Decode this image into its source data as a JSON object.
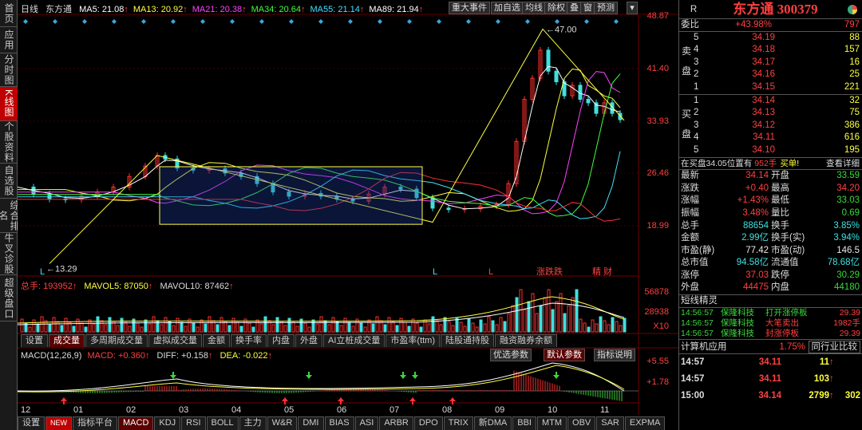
{
  "side_tabs": [
    "首页",
    "应用",
    "分时图",
    "K线图",
    "个股资料",
    "自选股",
    "综合排名",
    "牛叉诊股",
    "超级盘口"
  ],
  "legend": {
    "period": "日线",
    "name": "东方通",
    "ma": [
      {
        "t": "MA5: 21.08",
        "c": "#ffffff"
      },
      {
        "t": "MA13: 20.92",
        "c": "#ffff40"
      },
      {
        "t": "MA21: 20.38",
        "c": "#ff40ff"
      },
      {
        "t": "MA34: 20.64",
        "c": "#40ff40"
      },
      {
        "t": "MA55: 21.14",
        "c": "#40e0ff"
      },
      {
        "t": "MA89: 21.94",
        "c": "#ffffff"
      }
    ]
  },
  "toolbar": [
    "重大事件",
    "加自选",
    "均线",
    "除权",
    "叠",
    "窗",
    "预测"
  ],
  "price_axis": [
    "48.87",
    "41.40",
    "33.93",
    "26.46",
    "18.99"
  ],
  "annot_high": "47.00",
  "annot_low": "13.29",
  "markers_L": [
    "L",
    "L",
    "L",
    "L"
  ],
  "marker_special": "涨跌跌",
  "marker_jing": "精 财",
  "vol": {
    "label": "总手: 193952",
    "ma5": "MAVOL5: 87050",
    "ma10": "MAVOL10: 87462",
    "axis": [
      "56878",
      "28938",
      "X10"
    ]
  },
  "vol_tabs": [
    "设置",
    "成交量",
    "多周期成交量",
    "虚拟成交量",
    "金额",
    "换手率",
    "内盘",
    "外盘",
    "AI立桩成交量",
    "市盈率(ttm)",
    "陆股通持股",
    "融资融券余额"
  ],
  "macd": {
    "label": "MACD(12,26,9)",
    "macd": "MACD: +0.360",
    "diff": "DIFF: +0.158",
    "dea": "DEA: -0.022",
    "axis": [
      "+5.55",
      "+1.78"
    ],
    "btns": [
      "优选参数",
      "默认参数",
      "指标说明"
    ]
  },
  "months": [
    "12",
    "01",
    "02",
    "03",
    "04",
    "05",
    "06",
    "07",
    "08",
    "09",
    "10",
    "11"
  ],
  "bottom_tabs": [
    "设置",
    "NEW",
    "指标平台",
    "MACD",
    "KDJ",
    "RSI",
    "BOLL",
    "主力",
    "W&R",
    "DMI",
    "BIAS",
    "ASI",
    "ARBR",
    "DPO",
    "TRIX",
    "新DMA",
    "BBI",
    "MTM",
    "OBV",
    "SAR",
    "EXPMA"
  ],
  "stock": {
    "code_label": "R",
    "title": "东方通 300379"
  },
  "weibi": {
    "label": "委比",
    "pct": "+43.98%",
    "val": "797"
  },
  "asks": [
    {
      "n": "5",
      "p": "34.19",
      "v": "88"
    },
    {
      "n": "4",
      "p": "34.18",
      "v": "157"
    },
    {
      "n": "3",
      "p": "34.17",
      "v": "16"
    },
    {
      "n": "2",
      "p": "34.16",
      "v": "25"
    },
    {
      "n": "1",
      "p": "34.15",
      "v": "221"
    }
  ],
  "bids": [
    {
      "n": "1",
      "p": "34.14",
      "v": "32"
    },
    {
      "n": "2",
      "p": "34.13",
      "v": "75"
    },
    {
      "n": "3",
      "p": "34.12",
      "v": "386"
    },
    {
      "n": "4",
      "p": "34.11",
      "v": "616"
    },
    {
      "n": "5",
      "p": "34.10",
      "v": "195"
    }
  ],
  "ask_label": "卖盘",
  "bid_label": "买盘",
  "info_line": {
    "a": "在买盘34.05位置有",
    "b": "952手",
    "c": "买单!",
    "d": "查看详细"
  },
  "quotes": [
    {
      "l1": "最新",
      "v1": "34.14",
      "c1": "red",
      "l2": "开盘",
      "v2": "33.59",
      "c2": "green"
    },
    {
      "l1": "涨跌",
      "v1": "+0.40",
      "c1": "red",
      "l2": "最高",
      "v2": "34.20",
      "c2": "red"
    },
    {
      "l1": "涨幅",
      "v1": "+1.43%",
      "c1": "red",
      "l2": "最低",
      "v2": "33.03",
      "c2": "green"
    },
    {
      "l1": "振幅",
      "v1": "3.48%",
      "c1": "red",
      "l2": "量比",
      "v2": "0.69",
      "c2": "green"
    },
    {
      "l1": "总手",
      "v1": "88654",
      "c1": "cyan",
      "l2": "换手",
      "v2": "3.85%",
      "c2": "cyan"
    },
    {
      "l1": "金额",
      "v1": "2.99亿",
      "c1": "cyan",
      "l2": "换手(实)",
      "v2": "3.94%",
      "c2": "cyan"
    },
    {
      "l1": "市盈(静)",
      "v1": "77.42",
      "c1": "wht",
      "l2": "市盈(动)",
      "v2": "146.5",
      "c2": "wht"
    },
    {
      "l1": "总市值",
      "v1": "94.58亿",
      "c1": "cyan",
      "l2": "流通值",
      "v2": "78.68亿",
      "c2": "cyan"
    },
    {
      "l1": "涨停",
      "v1": "37.03",
      "c1": "red",
      "l2": "跌停",
      "v2": "30.29",
      "c2": "green"
    },
    {
      "l1": "外盘",
      "v1": "44475",
      "c1": "red",
      "l2": "内盘",
      "v2": "44180",
      "c2": "green"
    }
  ],
  "short_title": "短线精灵",
  "alerts": [
    {
      "t": "14:56:57",
      "n": "保隆科技",
      "a": "打开涨停板",
      "v": "29.39"
    },
    {
      "t": "14:56:57",
      "n": "保隆科技",
      "a": "大笔卖出",
      "v": "1982手"
    },
    {
      "t": "14:56:57",
      "n": "保隆科技",
      "a": "封涨停板",
      "v": "29.39"
    }
  ],
  "industry": {
    "name": "计算机应用",
    "pct": "1.75%",
    "btn": "同行业比较"
  },
  "ticks": [
    {
      "t": "14:57",
      "p": "34.11",
      "v": "11"
    },
    {
      "t": "14:57",
      "p": "34.11",
      "v": "103"
    },
    {
      "t": "15:00",
      "p": "34.14",
      "v": "2799"
    }
  ],
  "tick_extra": "302"
}
